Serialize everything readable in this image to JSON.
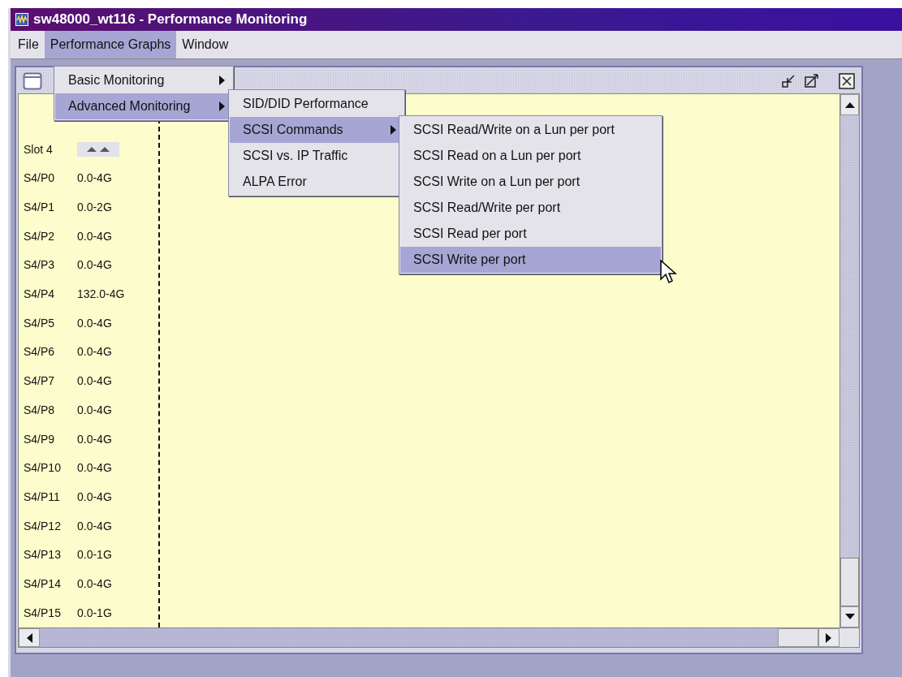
{
  "window": {
    "title": "sw48000_wt116 - Performance Monitoring"
  },
  "menubar": [
    {
      "label": "File",
      "selected": false
    },
    {
      "label": "Performance Graphs",
      "selected": true
    },
    {
      "label": "Window",
      "selected": false
    }
  ],
  "menus": [
    {
      "items": [
        {
          "label": "Basic Monitoring",
          "selected": false,
          "has_submenu": true
        },
        {
          "label": "Advanced Monitoring",
          "selected": true,
          "has_submenu": true
        }
      ]
    },
    {
      "items": [
        {
          "label": "SID/DID Performance",
          "selected": false,
          "has_submenu": false
        },
        {
          "label": "SCSI Commands",
          "selected": true,
          "has_submenu": true
        },
        {
          "label": "SCSI vs. IP Traffic",
          "selected": false,
          "has_submenu": false
        },
        {
          "label": "ALPA Error",
          "selected": false,
          "has_submenu": false
        }
      ]
    },
    {
      "items": [
        {
          "label": "SCSI Read/Write on a Lun per port",
          "selected": false,
          "has_submenu": false
        },
        {
          "label": "SCSI Read on a Lun per port",
          "selected": false,
          "has_submenu": false
        },
        {
          "label": "SCSI Write on a Lun per port",
          "selected": false,
          "has_submenu": false
        },
        {
          "label": "SCSI Read/Write per port",
          "selected": false,
          "has_submenu": false
        },
        {
          "label": "SCSI Read per port",
          "selected": false,
          "has_submenu": false
        },
        {
          "label": "SCSI Write per port",
          "selected": true,
          "has_submenu": false
        }
      ]
    }
  ],
  "slot": {
    "label": "Slot 4"
  },
  "ports": [
    {
      "name": "S4/P0",
      "range": "0.0-4G"
    },
    {
      "name": "S4/P1",
      "range": "0.0-2G"
    },
    {
      "name": "S4/P2",
      "range": "0.0-4G"
    },
    {
      "name": "S4/P3",
      "range": "0.0-4G"
    },
    {
      "name": "S4/P4",
      "range": "132.0-4G"
    },
    {
      "name": "S4/P5",
      "range": "0.0-4G"
    },
    {
      "name": "S4/P6",
      "range": "0.0-4G"
    },
    {
      "name": "S4/P7",
      "range": "0.0-4G"
    },
    {
      "name": "S4/P8",
      "range": "0.0-4G"
    },
    {
      "name": "S4/P9",
      "range": "0.0-4G"
    },
    {
      "name": "S4/P10",
      "range": "0.0-4G"
    },
    {
      "name": "S4/P11",
      "range": "0.0-4G"
    },
    {
      "name": "S4/P12",
      "range": "0.0-4G"
    },
    {
      "name": "S4/P13",
      "range": "0.0-1G"
    },
    {
      "name": "S4/P14",
      "range": "0.0-4G"
    },
    {
      "name": "S4/P15",
      "range": "0.0-1G"
    }
  ]
}
